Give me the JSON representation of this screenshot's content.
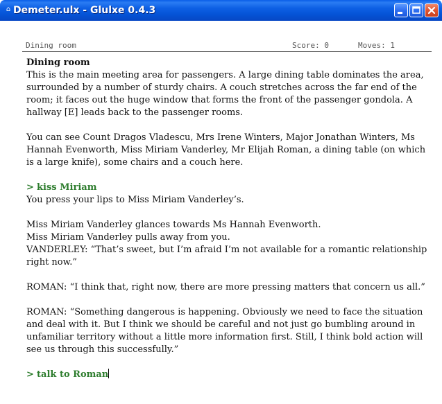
{
  "window": {
    "title": "Demeter.ulx - Glulxe 0.4.3",
    "icon": "app-icon",
    "buttons": [
      "minimize",
      "maximize",
      "close"
    ]
  },
  "status": {
    "location": "Dining room",
    "score": "Score: 0",
    "moves": "Moves: 1"
  },
  "story": {
    "room_title": "Dining room",
    "room_desc": "This is the main meeting area for passengers.  A large dining table dominates the area, surrounded by a number of sturdy chairs. A couch stretches across the far end of the room; it faces out the huge window that forms the front of the passenger gondola. A hallway [E] leads back to the passenger rooms.",
    "you_can_see": "You can see Count Dragos Vladescu, Mrs Irene Winters, Major Jonathan Winters, Ms Hannah Evenworth, Miss Miriam Vanderley, Mr Elijah Roman, a dining table (on which is a large knife), some chairs and a couch here.",
    "prompt": ">",
    "command1": "kiss Miriam",
    "response1": "You press your lips to Miss Miriam Vanderley’s.",
    "line_glance": "Miss Miriam Vanderley glances towards Ms Hannah Evenworth.",
    "line_pulls": "Miss Miriam Vanderley pulls away from you.",
    "line_vanderley": "VANDERLEY: “That’s sweet, but I’m afraid I’m not available for a romantic relationship right now.”",
    "line_roman1": "ROMAN: “I think that, right now, there are more pressing matters that concern us all.”",
    "line_roman2": "ROMAN: “Something dangerous is happening. Obviously we need to face the situation and deal with it. But I think we should be careful and not just go bumbling around in unfamiliar territory without a little more information first. Still, I think bold action will see us through this successfully.”",
    "command2": "talk to Roman"
  }
}
